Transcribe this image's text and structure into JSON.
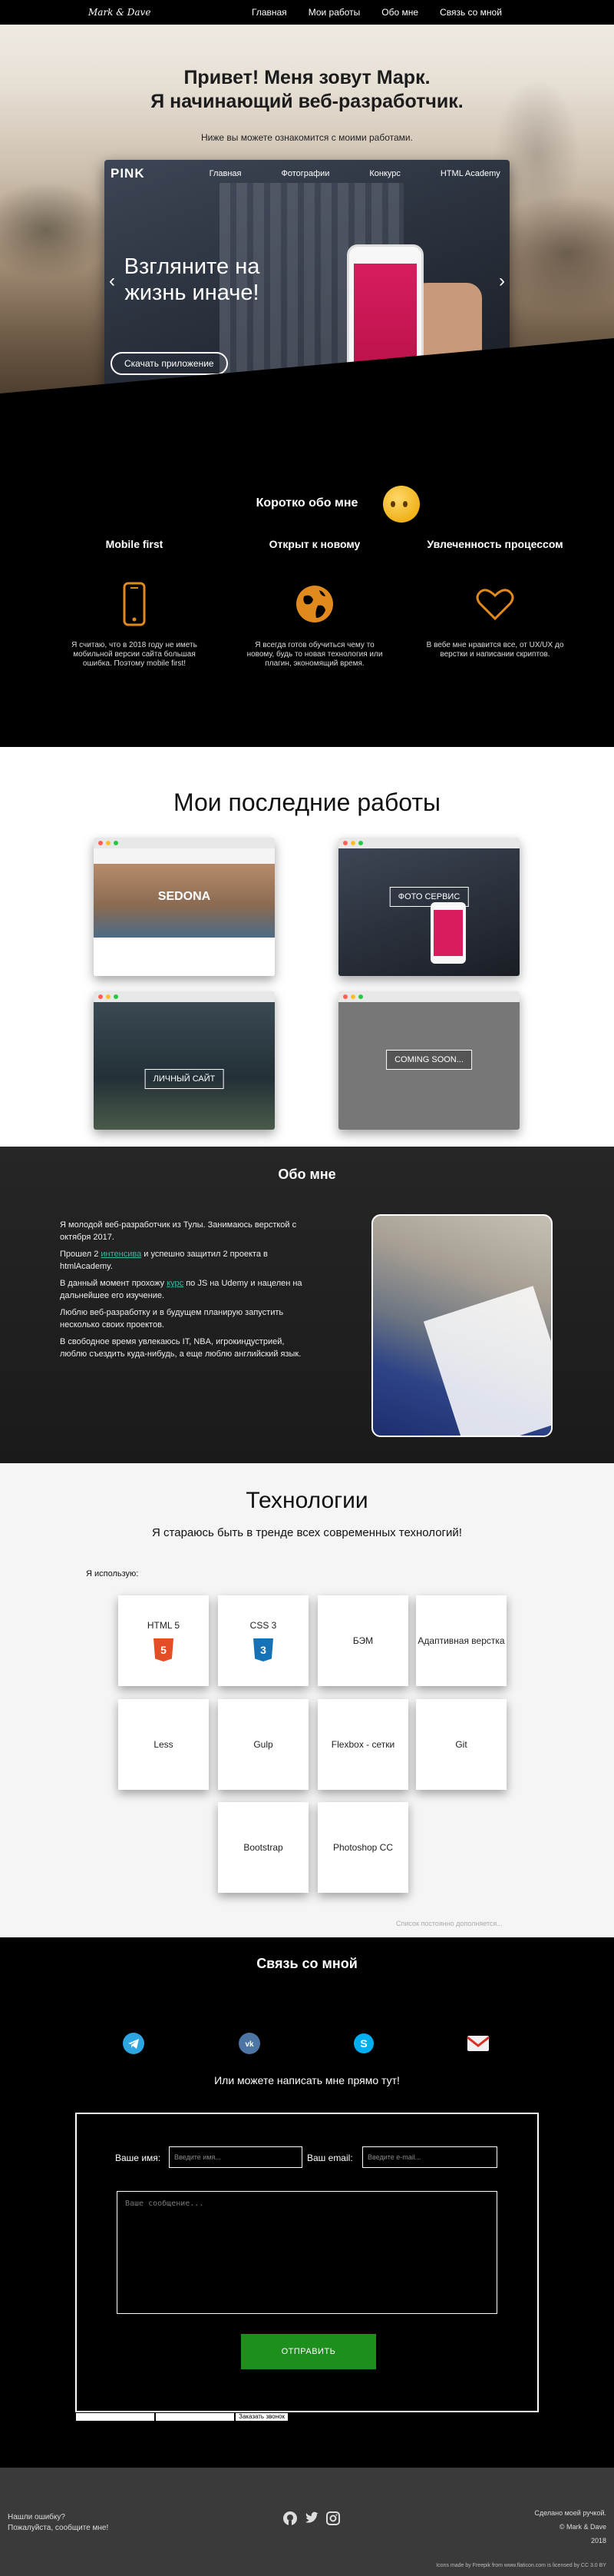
{
  "nav": {
    "logo": "Mark & Dave",
    "items": [
      "Главная",
      "Мои работы",
      "Обо мне",
      "Связь со мной"
    ]
  },
  "hero": {
    "title_line1": "Привет! Меня зовут Марк.",
    "title_line2": "Я начинающий веб-разработчик.",
    "subtitle": "Ниже вы можете ознакомится с моими работами.",
    "pink": {
      "logo": "PINK",
      "menu": [
        "Главная",
        "Фотографии",
        "Конкурс",
        "HTML Academy"
      ],
      "headline": "Взгляните на жизнь иначе!",
      "button": "Скачать приложение"
    }
  },
  "short": {
    "title": "Коротко обо мне",
    "columns": [
      {
        "heading": "Mobile first",
        "icon": "phone-icon",
        "text": "Я считаю, что в 2018 году не иметь мобильной версии сайта большая ошибка. Поэтому mobile first!"
      },
      {
        "heading": "Открыт к новому",
        "icon": "globe-icon",
        "text": "Я всегда готов обучиться чему то новому, будь то новая технология или плагин, экономящий время."
      },
      {
        "heading": "Увлеченность процессом",
        "icon": "heart-icon",
        "text": "В вебе мне нравится все, от UX/UX до верстки и написании скриптов."
      }
    ]
  },
  "works": {
    "title": "Мои последние работы",
    "cards": [
      {
        "caption": "SEDONA",
        "label": "sedona"
      },
      {
        "caption": "ФОТО СЕРВИС",
        "label": "pink"
      },
      {
        "caption": "ЛИЧНЫЙ САЙТ",
        "label": "personal"
      },
      {
        "caption": "COMING SOON...",
        "label": "coming-soon"
      }
    ]
  },
  "about": {
    "title": "Обо мне",
    "p1": "Я молодой веб-разработчик из Тулы. Занимаюсь версткой с октября 2017.",
    "p2a": "Прошел 2 ",
    "p2link": "интенсива",
    "p2b": " и успешно защитил 2 проекта в htmlAcademy.",
    "p3a": "В данный момент прохожу ",
    "p3link": "курс",
    "p3b": " по JS на Udemy и нацелен на дальнейшее его изучение.",
    "p4": "Люблю веб-разработку и в будущем планирую запустить несколько своих проектов.",
    "p5": "В свободное время увлекаюсь IT, NBA, игрокиндустрией, люблю съездить куда-нибудь, а еще люблю английский язык."
  },
  "tech": {
    "title": "Технологии",
    "lead": "Я стараюсь быть в тренде всех современных технологий!",
    "use": "Я использую:",
    "tiles": [
      "HTML 5",
      "CSS 3",
      "БЭМ",
      "Адаптивная верстка",
      "Less",
      "Gulp",
      "Flexbox - сетки",
      "Git",
      "Bootstrap",
      "Photoshop CC"
    ],
    "note": "Список постоянно дополняется..."
  },
  "contact": {
    "title": "Связь со мной",
    "or": "Или можете написать мне прямо тут!",
    "name_label": "Ваше имя:",
    "name_placeholder": "Введите имя...",
    "email_label": "Ваш email:",
    "email_placeholder": "Введите e-mail...",
    "message_placeholder": "Ваше сообщение...",
    "submit": "ОТПРАВИТЬ",
    "strip_btn": "Заказать звонок"
  },
  "footer": {
    "left1": "Нашли ошибку?",
    "left2": "Пожалуйста, сообщите мне!",
    "right1": "Сделано моей ручкой.",
    "right2": "© Mark & Dave",
    "right3": "2018",
    "credits": "Icons made by Freepik from www.flaticon.com is licensed by CC 3.0 BY"
  },
  "colors": {
    "accent_green": "#1d8f1d",
    "link_teal": "#3bb5a3",
    "icon_orange": "#e08a1e"
  }
}
